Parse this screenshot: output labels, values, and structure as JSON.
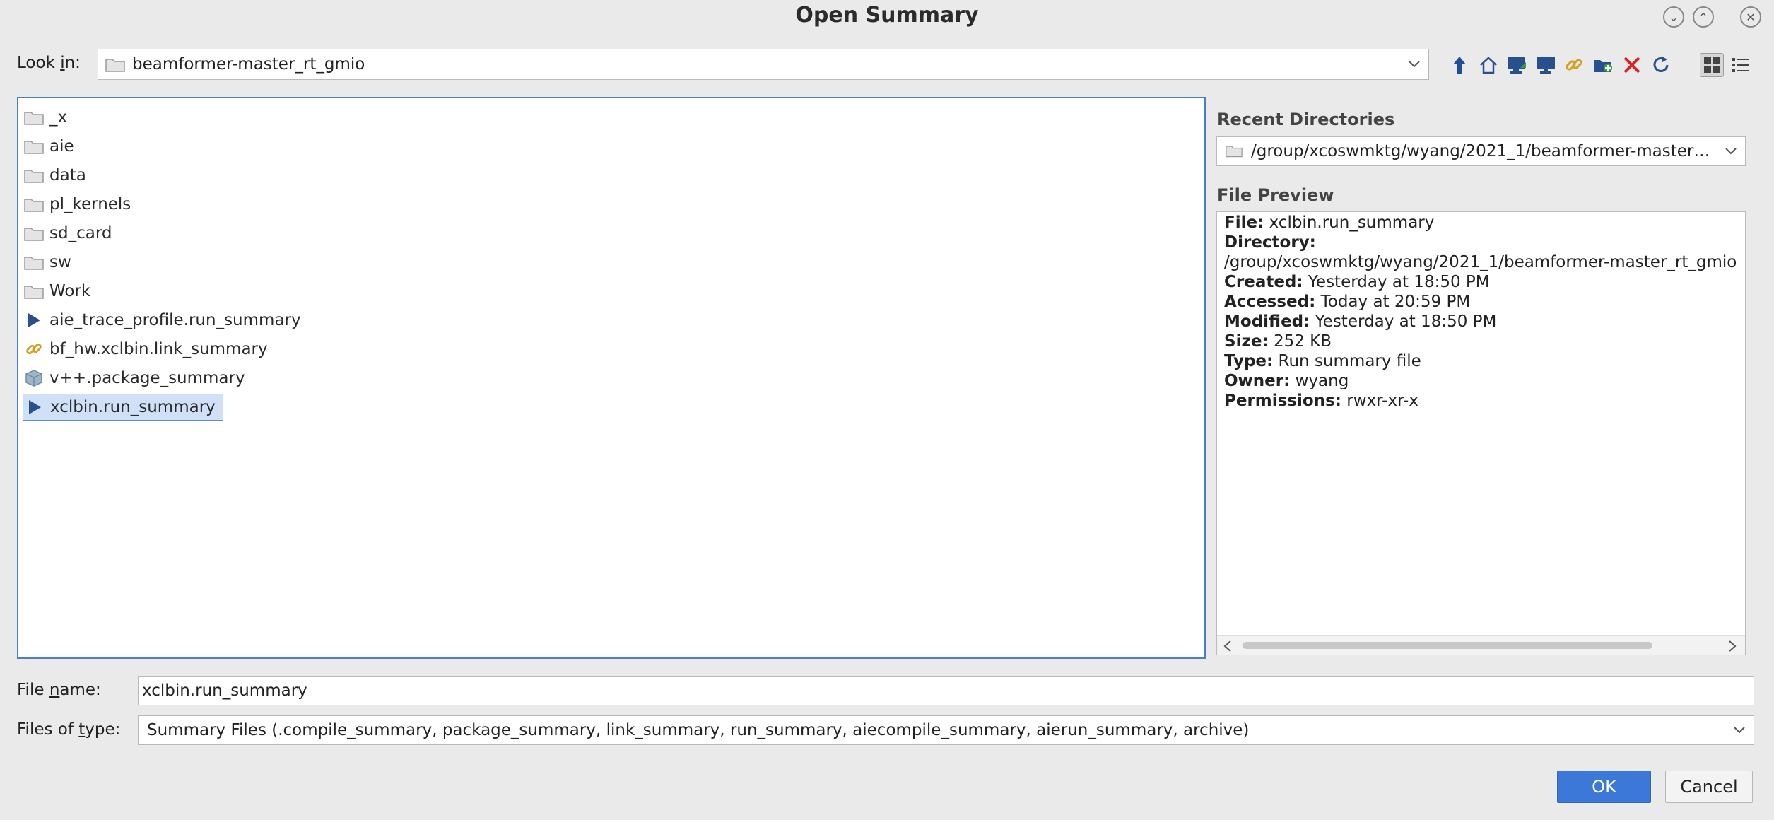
{
  "window": {
    "title": "Open Summary"
  },
  "lookin": {
    "label_pre": "Look ",
    "label_mnemonic": "i",
    "label_post": "n:",
    "value": "beamformer-master_rt_gmio"
  },
  "toolbar": {
    "icons": [
      "up-arrow-icon",
      "home-icon",
      "desktop-icon",
      "computer-icon",
      "link-icon",
      "new-folder-icon",
      "delete-icon",
      "refresh-icon",
      "grid-view-icon",
      "list-view-icon"
    ]
  },
  "files": [
    {
      "name": "_x",
      "icon": "folder-icon"
    },
    {
      "name": "aie",
      "icon": "folder-icon"
    },
    {
      "name": "data",
      "icon": "folder-icon"
    },
    {
      "name": "pl_kernels",
      "icon": "folder-icon"
    },
    {
      "name": "sd_card",
      "icon": "folder-icon"
    },
    {
      "name": "sw",
      "icon": "folder-icon"
    },
    {
      "name": "Work",
      "icon": "folder-icon"
    },
    {
      "name": "aie_trace_profile.run_summary",
      "icon": "run-icon"
    },
    {
      "name": "bf_hw.xclbin.link_summary",
      "icon": "link-icon"
    },
    {
      "name": "v++.package_summary",
      "icon": "package-icon"
    },
    {
      "name": "xclbin.run_summary",
      "icon": "run-icon",
      "selected": true
    }
  ],
  "recent": {
    "heading": "Recent Directories",
    "value": "/group/xcoswmktg/wyang/2021_1/beamformer-master_..."
  },
  "preview": {
    "heading": "File Preview",
    "lines": [
      {
        "label": "File:",
        "value": " xclbin.run_summary"
      },
      {
        "label": "Directory:",
        "value": ""
      },
      {
        "label": "",
        "value": "/group/xcoswmktg/wyang/2021_1/beamformer-master_rt_gmio"
      },
      {
        "label": "Created:",
        "value": " Yesterday at 18:50 PM"
      },
      {
        "label": "Accessed:",
        "value": " Today at 20:59 PM"
      },
      {
        "label": "Modified:",
        "value": " Yesterday at 18:50 PM"
      },
      {
        "label": "Size:",
        "value": " 252 KB"
      },
      {
        "label": "Type:",
        "value": " Run summary file"
      },
      {
        "label": "Owner:",
        "value": " wyang"
      },
      {
        "label": "Permissions:",
        "value": " rwxr-xr-x"
      }
    ]
  },
  "filename": {
    "label_pre": "File ",
    "label_mnemonic": "n",
    "label_post": "ame:",
    "value": "xclbin.run_summary"
  },
  "filetype": {
    "label_pre": "Files of ",
    "label_mnemonic": "t",
    "label_post": "ype:",
    "value": "Summary Files (.compile_summary, package_summary, link_summary, run_summary, aiecompile_summary, aierun_summary, archive)"
  },
  "buttons": {
    "ok": "OK",
    "cancel": "Cancel"
  },
  "colors": {
    "accent": "#3b78d8",
    "selection": "#cfe0f7",
    "delete": "#d92020",
    "link": "#d4a020"
  }
}
